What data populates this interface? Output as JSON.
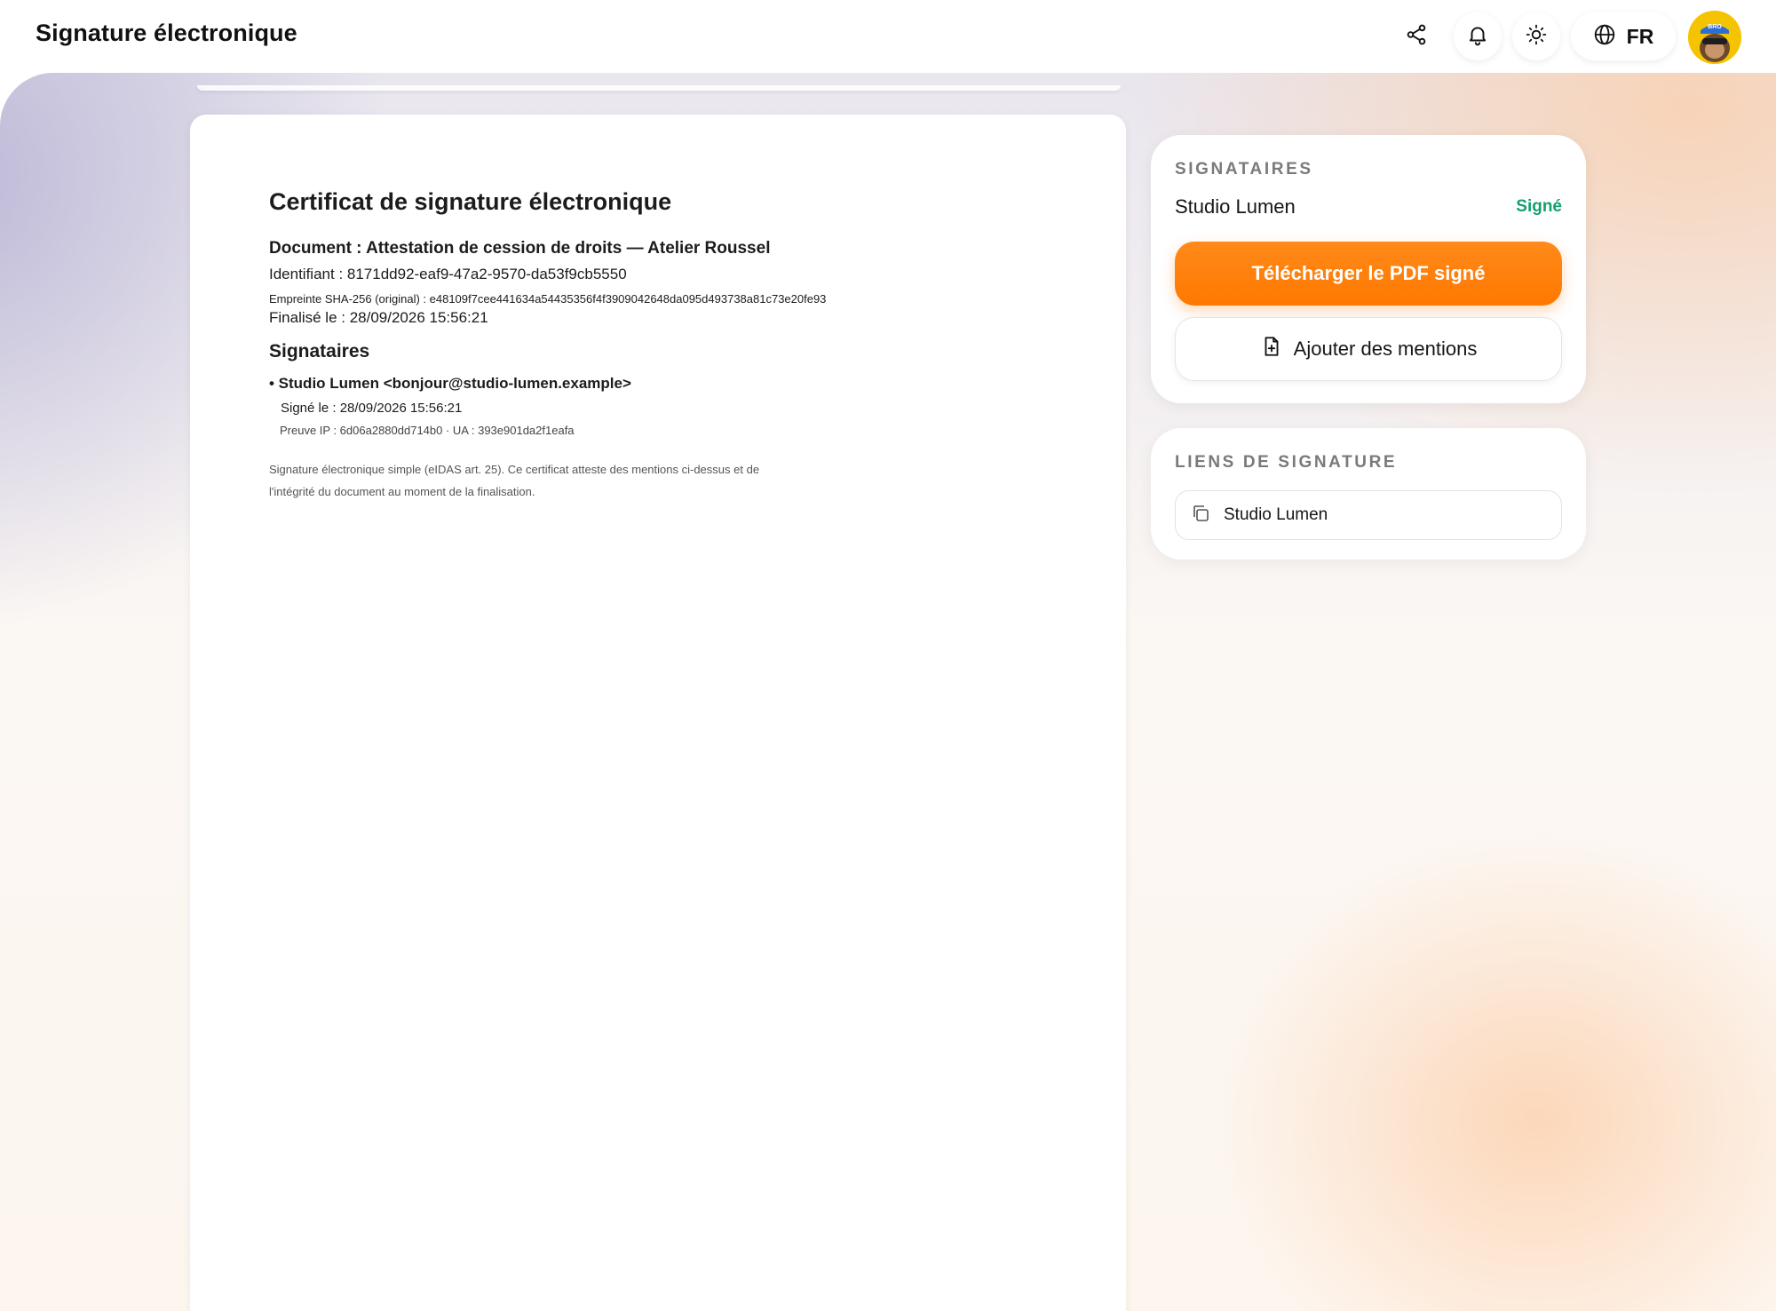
{
  "header": {
    "title": "Signature électronique",
    "language": "FR",
    "icons": {
      "share": "share-icon",
      "notifications": "bell-icon",
      "theme": "sun-icon",
      "language": "globe-icon"
    },
    "avatar_text": "BRO"
  },
  "document": {
    "title": "Certificat de signature électronique",
    "document_line": "Document : Attestation de cession de droits — Atelier Roussel",
    "identifier_line": "Identifiant : 8171dd92-eaf9-47a2-9570-da53f9cb5550",
    "fingerprint_line": "Empreinte SHA-256 (original) : e48109f7cee441634a54435356f4f3909042648da095d493738a81c73e20fe93",
    "finalized_line": "Finalisé le : 28/09/2026 15:56:21",
    "signers_heading": "Signataires",
    "signer_line": "• Studio Lumen <bonjour@studio-lumen.example>",
    "signed_at_line": "Signé le : 28/09/2026 15:56:21",
    "proof_line": "Preuve IP : 6d06a2880dd714b0 · UA : 393e901da2f1eafa",
    "footnote": "Signature électronique simple (eIDAS art. 25). Ce certificat atteste des mentions ci-dessus et de l'intégrité du document au moment de la finalisation."
  },
  "signers_card": {
    "heading": "SIGNATAIRES",
    "signer_name": "Studio Lumen",
    "signer_status": "Signé",
    "download_label": "Télécharger le PDF signé",
    "add_mentions_label": "Ajouter des mentions"
  },
  "links_card": {
    "heading": "LIENS DE SIGNATURE",
    "link_label": "Studio Lumen"
  },
  "colors": {
    "accent": "#ff7800",
    "signed_status": "#14a06b"
  }
}
